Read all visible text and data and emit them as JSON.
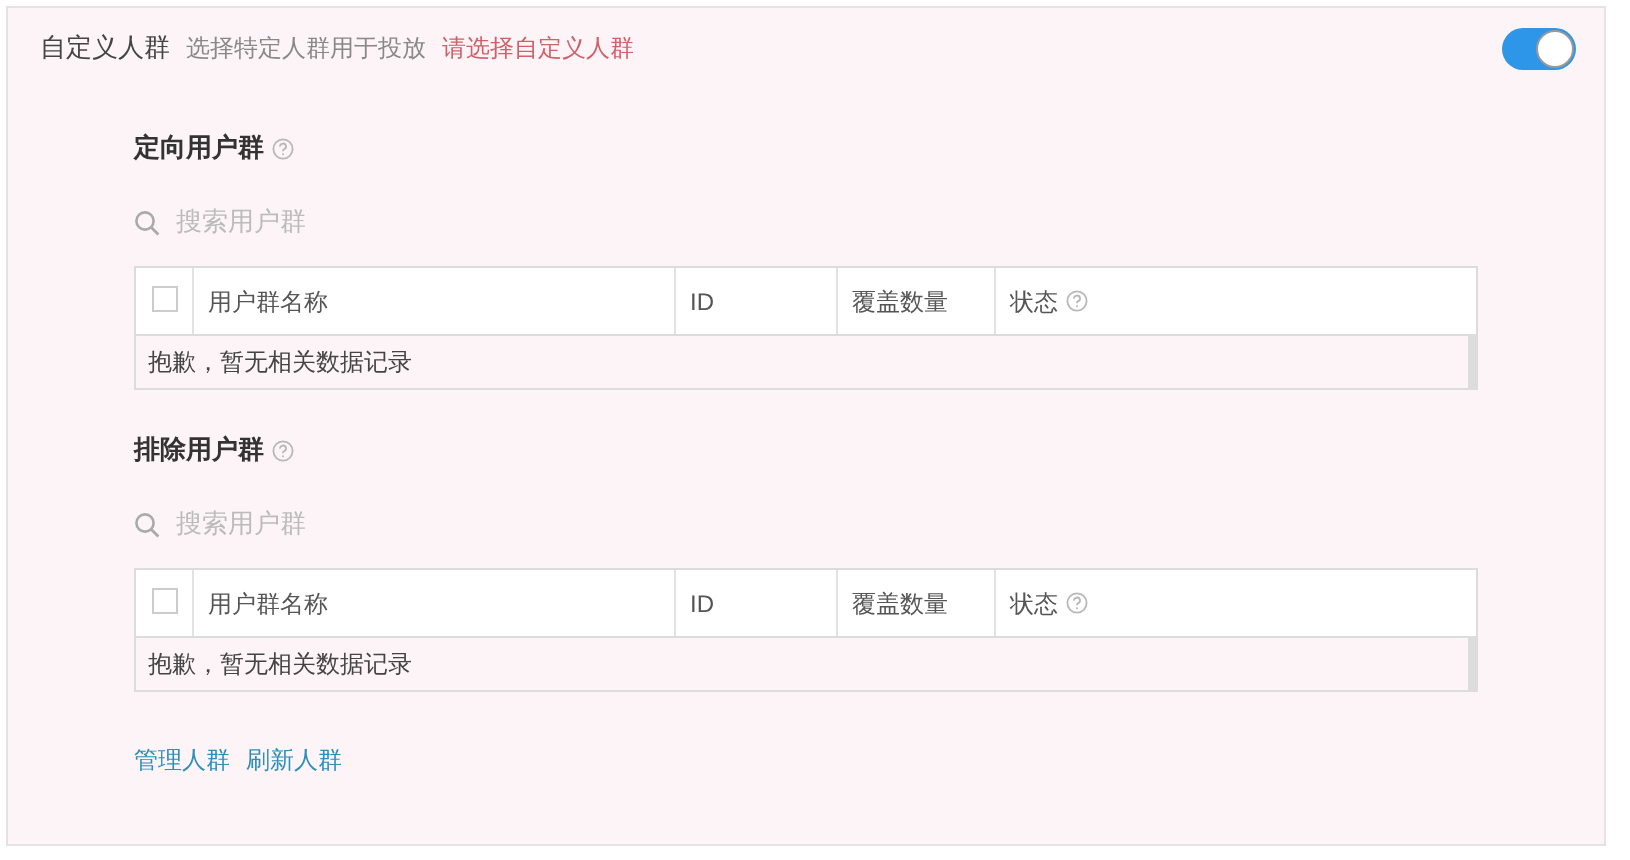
{
  "header": {
    "title": "自定义人群",
    "description": "选择特定人群用于投放",
    "error": "请选择自定义人群",
    "toggle": {
      "on": true
    }
  },
  "sections": [
    {
      "title": "定向用户群",
      "search": {
        "placeholder": "搜索用户群"
      },
      "table": {
        "select_all": {
          "checked": false
        },
        "columns": [
          "用户群名称",
          "ID",
          "覆盖数量",
          "状态"
        ],
        "empty_message": "抱歉，暂无相关数据记录"
      }
    },
    {
      "title": "排除用户群",
      "search": {
        "placeholder": "搜索用户群"
      },
      "table": {
        "select_all": {
          "checked": false
        },
        "columns": [
          "用户群名称",
          "ID",
          "覆盖数量",
          "状态"
        ],
        "empty_message": "抱歉，暂无相关数据记录"
      }
    }
  ],
  "links": [
    "管理人群",
    "刷新人群"
  ]
}
